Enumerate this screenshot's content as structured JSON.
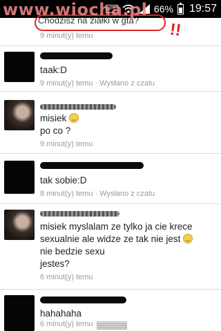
{
  "status_bar": {
    "nfc": "NFC",
    "battery_pct": "66%",
    "time": "19:57"
  },
  "watermark": "www.wiocha.pl",
  "top_message": {
    "text": "Chodzisz na ziałki w gta?",
    "meta": "9 minut(y) temu",
    "annotation": "!!"
  },
  "messages": [
    {
      "text": "taak:D",
      "meta": "9 minut(y) temu · Wysłano z czatu"
    },
    {
      "lines": [
        "misiek",
        "po co ?"
      ],
      "meta": "9 minut(y) temu"
    },
    {
      "text": "tak sobie:D",
      "meta": "8 minut(y) temu · Wysłano z czatu"
    },
    {
      "lines": [
        "misiek myslalam ze tylko ja cie krece",
        "sexualnie ale widze ze tak nie jest",
        "nie bedzie sexu",
        "jestes?"
      ],
      "meta": "6 minut(y) temu"
    },
    {
      "text": "hahahaha",
      "meta": "6 minut(y) temu"
    }
  ],
  "icons": [
    "signal-icon",
    "battery-icon",
    "emoji-smile-icon"
  ],
  "colors": {
    "annotation_red": "#e02020",
    "watermark": "#f08a8a",
    "meta_gray": "#9a9a9a"
  }
}
